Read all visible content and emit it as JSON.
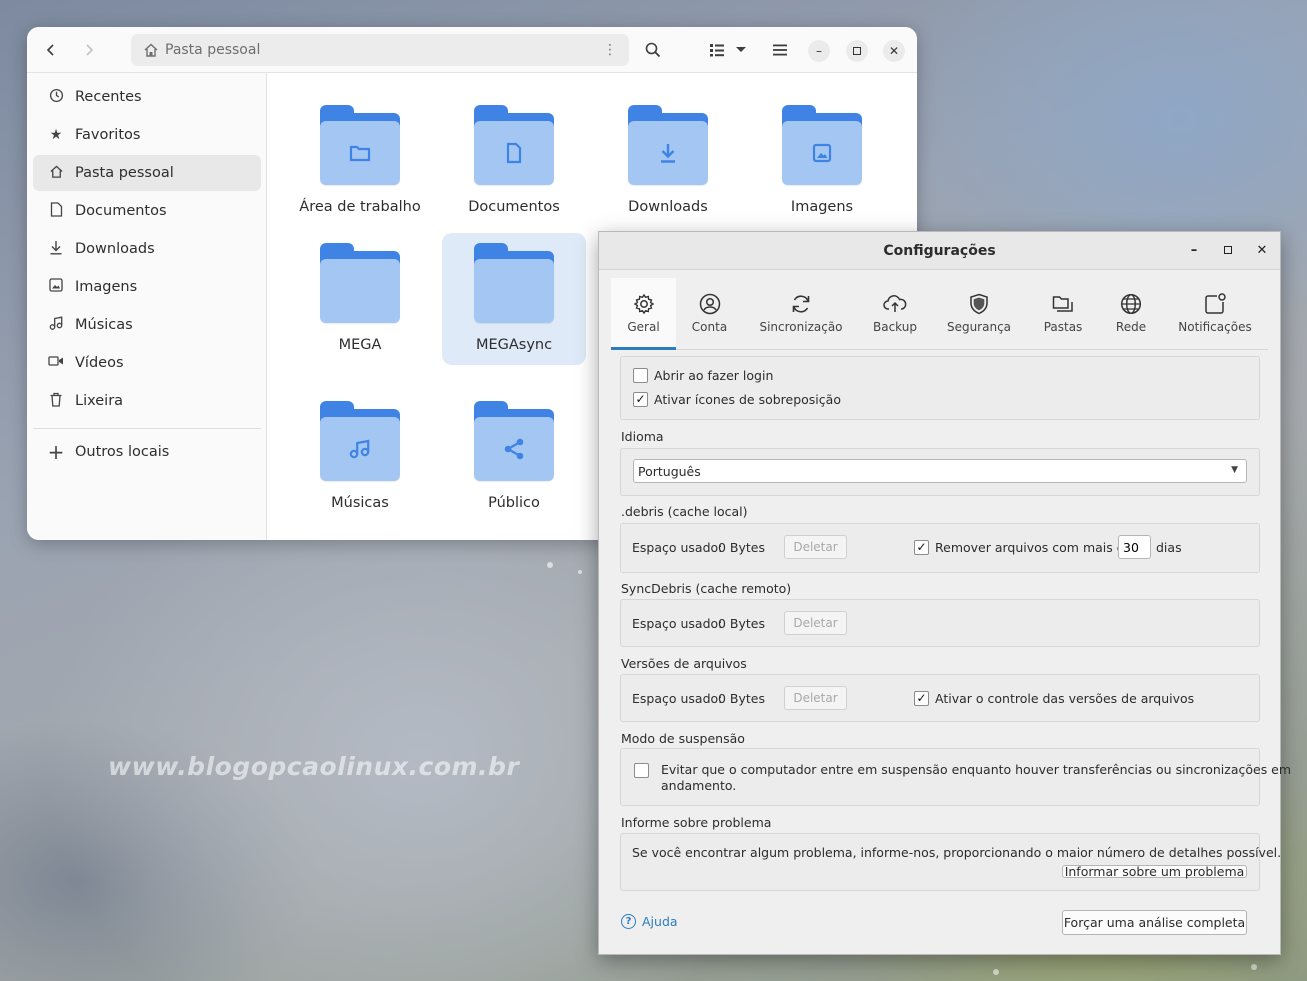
{
  "watermark": "www.blogopcaolinux.com.br",
  "file_manager": {
    "path": "Pasta pessoal",
    "sidebar": [
      {
        "label": "Recentes",
        "icon": "clock-icon"
      },
      {
        "label": "Favoritos",
        "icon": "star-icon"
      },
      {
        "label": "Pasta pessoal",
        "icon": "home-icon",
        "active": true
      },
      {
        "label": "Documentos",
        "icon": "document-icon"
      },
      {
        "label": "Downloads",
        "icon": "download-icon"
      },
      {
        "label": "Imagens",
        "icon": "image-icon"
      },
      {
        "label": "Músicas",
        "icon": "music-icon"
      },
      {
        "label": "Vídeos",
        "icon": "video-icon"
      },
      {
        "label": "Lixeira",
        "icon": "trash-icon"
      },
      {
        "label": "Outros locais",
        "icon": "plus-icon"
      }
    ],
    "folders": [
      {
        "label": "Área de trabalho",
        "icon": "desktop-folder-icon"
      },
      {
        "label": "Documentos",
        "icon": "documents-folder-icon"
      },
      {
        "label": "Downloads",
        "icon": "downloads-folder-icon"
      },
      {
        "label": "Imagens",
        "icon": "pictures-folder-icon"
      },
      {
        "label": "MEGA",
        "icon": "folder-icon"
      },
      {
        "label": "MEGAsync",
        "icon": "folder-icon",
        "selected": true
      },
      {
        "label": "Músicas",
        "icon": "music-folder-icon"
      },
      {
        "label": "Público",
        "icon": "public-folder-icon"
      }
    ]
  },
  "settings": {
    "title": "Configurações",
    "tabs": [
      {
        "label": "Geral",
        "icon": "gear-icon",
        "active": true
      },
      {
        "label": "Conta",
        "icon": "account-icon"
      },
      {
        "label": "Sincronização",
        "icon": "sync-icon"
      },
      {
        "label": "Backup",
        "icon": "cloud-upload-icon"
      },
      {
        "label": "Segurança",
        "icon": "shield-icon"
      },
      {
        "label": "Pastas",
        "icon": "folders-icon"
      },
      {
        "label": "Rede",
        "icon": "globe-icon"
      },
      {
        "label": "Notificações",
        "icon": "notification-icon"
      }
    ],
    "startup": {
      "login_label": "Abrir ao fazer login",
      "login_checked": false,
      "overlay_label": "Ativar ícones de sobreposição",
      "overlay_checked": true
    },
    "language": {
      "section": "Idioma",
      "value": "Português"
    },
    "debris": {
      "section": ".debris (cache local)",
      "used_label": "Espaço usado:",
      "used_value": "0 Bytes",
      "delete_label": "Deletar",
      "remove_label": "Remover arquivos com mais de",
      "remove_checked": true,
      "days_value": "30",
      "days_label": "dias"
    },
    "syncdebris": {
      "section": "SyncDebris (cache remoto)",
      "used_label": "Espaço usado:",
      "used_value": "0 Bytes",
      "delete_label": "Deletar"
    },
    "versions": {
      "section": "Versões de arquivos",
      "used_label": "Espaço usado:",
      "used_value": "0 Bytes",
      "delete_label": "Deletar",
      "enable_label": "Ativar o controle das versões de arquivos",
      "enable_checked": true
    },
    "sleep": {
      "section": "Modo de suspensão",
      "line1": "Evitar que o computador entre em suspensão enquanto houver transferências ou sincronizações em",
      "line2": "andamento.",
      "checked": false
    },
    "report": {
      "section": "Informe sobre problema",
      "text": "Se você encontrar algum problema, informe-nos, proporcionando o maior número de detalhes possível.",
      "button": "Informar sobre um problema"
    },
    "help_label": "Ajuda",
    "full_scan_button": "Forçar uma análise completa"
  }
}
